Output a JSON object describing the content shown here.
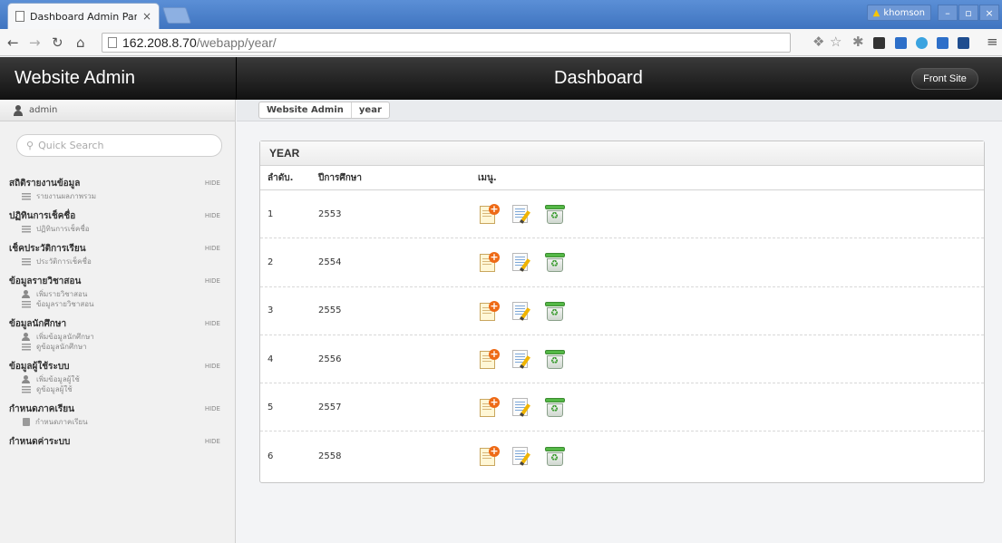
{
  "browser": {
    "tab_title": "Dashboard Admin Panel",
    "tab_close": "×",
    "profile_name": "khomson",
    "url_host": "162.208.8.70",
    "url_path": "/webapp/year/"
  },
  "header": {
    "brand": "Website Admin",
    "title": "Dashboard",
    "front_site_label": "Front Site"
  },
  "sidebar": {
    "username": "admin",
    "search_placeholder": "Quick Search",
    "hide_label": "HIDE",
    "sections": [
      {
        "title": "สถิติรายงานข้อมูล",
        "items": [
          "รายงานผลภาพรวม"
        ]
      },
      {
        "title": "ปฏิทินการเช็คชื่อ",
        "items": [
          "ปฏิทินการเช็คชื่อ"
        ]
      },
      {
        "title": "เช็คประวัติการเรียน",
        "items": [
          "ประวัติการเช็คชื่อ"
        ]
      },
      {
        "title": "ข้อมูลรายวิชาสอน",
        "items": [
          "เพิ่มรายวิชาสอน",
          "ข้อมูลรายวิชาสอน"
        ]
      },
      {
        "title": "ข้อมูลนักศึกษา",
        "items": [
          "เพิ่มข้อมูลนักศึกษา",
          "ดูข้อมูลนักศึกษา"
        ]
      },
      {
        "title": "ข้อมูลผู้ใช้ระบบ",
        "items": [
          "เพิ่มข้อมูลผู้ใช้",
          "ดูข้อมูลผู้ใช้"
        ]
      },
      {
        "title": "กำหนดภาคเรียน",
        "items": [
          "กำหนดภาคเรียน"
        ]
      },
      {
        "title": "กำหนดค่าระบบ",
        "items": []
      }
    ]
  },
  "breadcrumb": [
    "Website Admin",
    "year"
  ],
  "panel": {
    "title": "YEAR",
    "columns": [
      "ลำดับ.",
      "ปีการศึกษา",
      "เมนู."
    ],
    "rows": [
      {
        "no": "1",
        "year": "2553"
      },
      {
        "no": "2",
        "year": "2554"
      },
      {
        "no": "3",
        "year": "2555"
      },
      {
        "no": "4",
        "year": "2556"
      },
      {
        "no": "5",
        "year": "2557"
      },
      {
        "no": "6",
        "year": "2558"
      }
    ]
  }
}
